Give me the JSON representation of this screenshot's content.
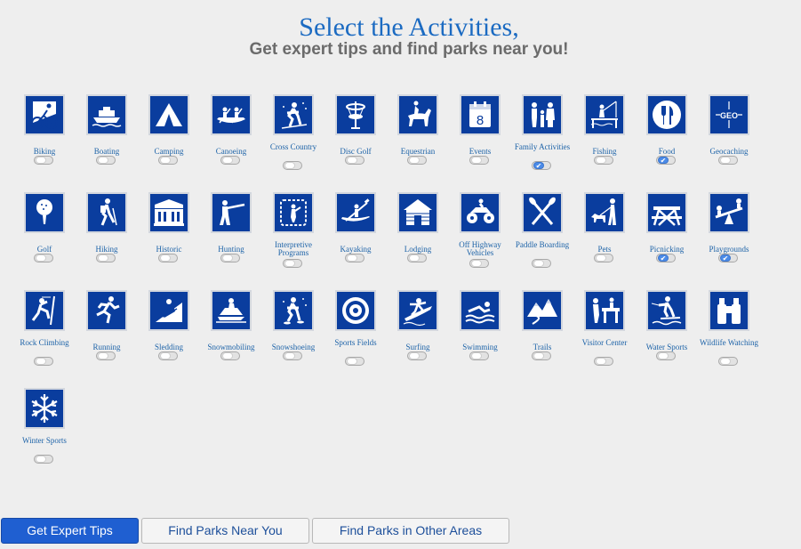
{
  "title": "Select the Activities,",
  "subtitle": "Get expert tips and find parks near you!",
  "activities": [
    {
      "label": "Biking",
      "icon": "bike-icon",
      "checked": false
    },
    {
      "label": "Boating",
      "icon": "boat-icon",
      "checked": false
    },
    {
      "label": "Camping",
      "icon": "tent-icon",
      "checked": false
    },
    {
      "label": "Canoeing",
      "icon": "canoe-icon",
      "checked": false
    },
    {
      "label": "Cross Country",
      "icon": "cross-country-ski-icon",
      "checked": false
    },
    {
      "label": "Disc Golf",
      "icon": "disc-golf-basket-icon",
      "checked": false
    },
    {
      "label": "Equestrian",
      "icon": "horse-rider-icon",
      "checked": false
    },
    {
      "label": "Events",
      "icon": "calendar-icon",
      "checked": false,
      "calendar_day": "8"
    },
    {
      "label": "Family Activities",
      "icon": "family-icon",
      "checked": true
    },
    {
      "label": "Fishing",
      "icon": "fishing-icon",
      "checked": false
    },
    {
      "label": "Food",
      "icon": "fork-knife-icon",
      "checked": true
    },
    {
      "label": "Geocaching",
      "icon": "geo-icon",
      "checked": false,
      "badge_text": "GEO"
    },
    {
      "label": "Golf",
      "icon": "golf-ball-icon",
      "checked": false
    },
    {
      "label": "Hiking",
      "icon": "hiker-icon",
      "checked": false
    },
    {
      "label": "Historic",
      "icon": "historic-building-icon",
      "checked": false
    },
    {
      "label": "Hunting",
      "icon": "hunter-icon",
      "checked": false
    },
    {
      "label": "Interpretive Programs",
      "icon": "interpretive-programs-icon",
      "checked": false
    },
    {
      "label": "Kayaking",
      "icon": "kayak-icon",
      "checked": false
    },
    {
      "label": "Lodging",
      "icon": "cabin-icon",
      "checked": false
    },
    {
      "label": "Off Highway Vehicles",
      "icon": "atv-icon",
      "checked": false
    },
    {
      "label": "Paddle Boarding",
      "icon": "paddles-icon",
      "checked": false
    },
    {
      "label": "Pets",
      "icon": "dog-walker-icon",
      "checked": false
    },
    {
      "label": "Picnicking",
      "icon": "picnic-table-icon",
      "checked": true
    },
    {
      "label": "Playgrounds",
      "icon": "seesaw-icon",
      "checked": true
    },
    {
      "label": "Rock Climbing",
      "icon": "climber-icon",
      "checked": false
    },
    {
      "label": "Running",
      "icon": "runner-icon",
      "checked": false
    },
    {
      "label": "Sledding",
      "icon": "sled-icon",
      "checked": false
    },
    {
      "label": "Snowmobiling",
      "icon": "snowmobile-icon",
      "checked": false
    },
    {
      "label": "Snowshoeing",
      "icon": "snowshoer-icon",
      "checked": false
    },
    {
      "label": "Sports Fields",
      "icon": "target-icon",
      "checked": false
    },
    {
      "label": "Surfing",
      "icon": "surfer-icon",
      "checked": false
    },
    {
      "label": "Swimming",
      "icon": "swimmer-icon",
      "checked": false
    },
    {
      "label": "Trails",
      "icon": "mountain-trail-icon",
      "checked": false
    },
    {
      "label": "Visitor Center",
      "icon": "visitor-center-icon",
      "checked": false
    },
    {
      "label": "Water Sports",
      "icon": "water-ski-icon",
      "checked": false
    },
    {
      "label": "Wildlife Watching",
      "icon": "binoculars-icon",
      "checked": false
    },
    {
      "label": "Winter Sports",
      "icon": "snowflake-icon",
      "checked": false
    }
  ],
  "buttons": [
    {
      "label": "Get Expert Tips",
      "style": "primary"
    },
    {
      "label": "Find Parks Near You",
      "style": "secondary"
    },
    {
      "label": "Find Parks in Other Areas",
      "style": "secondary"
    }
  ],
  "colors": {
    "accent": "#1c6bc2",
    "icon_bg": "#0a3d9e",
    "toggle_on": "#4b8be8",
    "primary_button": "#1f5fd1"
  }
}
